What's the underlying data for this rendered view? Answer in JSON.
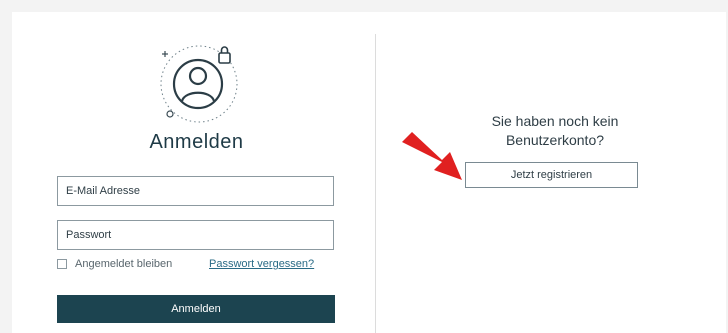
{
  "login": {
    "title": "Anmelden",
    "email_placeholder": "E-Mail Adresse",
    "password_placeholder": "Passwort",
    "remember_label": "Angemeldet bleiben",
    "forgot_link": "Passwort vergessen?",
    "submit_label": "Anmelden"
  },
  "register": {
    "line1": "Sie haben noch kein",
    "line2": "Benutzerkonto?",
    "button_label": "Jetzt registrieren"
  },
  "colors": {
    "primary_dark": "#1c4450",
    "link": "#2a6b86",
    "annotation_arrow": "#e02020"
  },
  "icons": {
    "avatar": "user-circle-icon",
    "lock": "lock-icon",
    "arrow": "red-arrow-icon"
  }
}
